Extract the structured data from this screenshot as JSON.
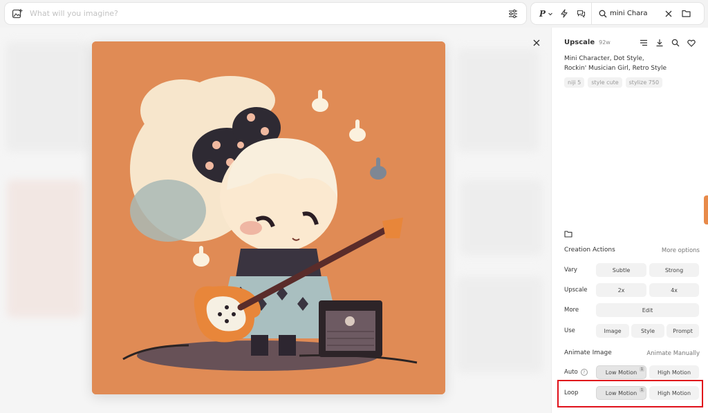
{
  "prompt_bar": {
    "placeholder": "What will you imagine?"
  },
  "tools": {
    "search_value": "mini Chara"
  },
  "panel": {
    "job_label": "Upscale",
    "job_age": "92w",
    "prompt_line1": "Mini Character, Dot Style,",
    "prompt_line2": "Rockin' Musician Girl, Retro Style",
    "params": [
      "niji 5",
      "style cute",
      "stylize 750"
    ],
    "creation_actions_title": "Creation Actions",
    "more_options": "More options",
    "rows": {
      "vary": {
        "label": "Vary",
        "buttons": [
          "Subtle",
          "Strong"
        ]
      },
      "upscale": {
        "label": "Upscale",
        "buttons": [
          "2x",
          "4x"
        ]
      },
      "more": {
        "label": "More",
        "buttons": [
          "Edit"
        ]
      },
      "use": {
        "label": "Use",
        "buttons": [
          "Image",
          "Style",
          "Prompt"
        ]
      }
    },
    "animate_title": "Animate Image",
    "animate_manually": "Animate Manually",
    "auto": {
      "label": "Auto",
      "buttons": [
        "Low Motion",
        "High Motion"
      ],
      "badge": "1"
    },
    "loop": {
      "label": "Loop",
      "buttons": [
        "Low Motion",
        "High Motion"
      ],
      "badge": "1"
    }
  },
  "colors": {
    "artwork_bg": "#e08b55",
    "highlight": "#e0101a",
    "side_tab": "#e88a4a"
  }
}
